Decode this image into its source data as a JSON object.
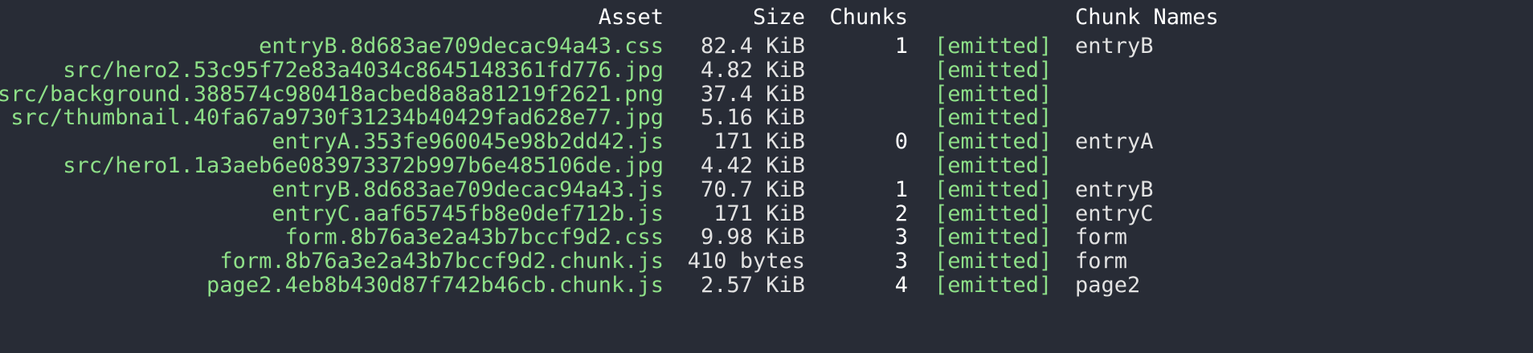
{
  "header": {
    "asset": "Asset",
    "size": "Size",
    "chunks": "Chunks",
    "status": "",
    "chunk_names": "Chunk Names"
  },
  "rows": [
    {
      "asset": "entryB.8d683ae709decac94a43.css",
      "size": "82.4 KiB",
      "chunks": "1",
      "status": "[emitted]",
      "names": "entryB"
    },
    {
      "asset": "src/hero2.53c95f72e83a4034c8645148361fd776.jpg",
      "size": "4.82 KiB",
      "chunks": "",
      "status": "[emitted]",
      "names": ""
    },
    {
      "asset": "src/background.388574c980418acbed8a8a81219f2621.png",
      "size": "37.4 KiB",
      "chunks": "",
      "status": "[emitted]",
      "names": ""
    },
    {
      "asset": "src/thumbnail.40fa67a9730f31234b40429fad628e77.jpg",
      "size": "5.16 KiB",
      "chunks": "",
      "status": "[emitted]",
      "names": ""
    },
    {
      "asset": "entryA.353fe960045e98b2dd42.js",
      "size": "171 KiB",
      "chunks": "0",
      "status": "[emitted]",
      "names": "entryA"
    },
    {
      "asset": "src/hero1.1a3aeb6e083973372b997b6e485106de.jpg",
      "size": "4.42 KiB",
      "chunks": "",
      "status": "[emitted]",
      "names": ""
    },
    {
      "asset": "entryB.8d683ae709decac94a43.js",
      "size": "70.7 KiB",
      "chunks": "1",
      "status": "[emitted]",
      "names": "entryB"
    },
    {
      "asset": "entryC.aaf65745fb8e0def712b.js",
      "size": "171 KiB",
      "chunks": "2",
      "status": "[emitted]",
      "names": "entryC"
    },
    {
      "asset": "form.8b76a3e2a43b7bccf9d2.css",
      "size": "9.98 KiB",
      "chunks": "3",
      "status": "[emitted]",
      "names": "form"
    },
    {
      "asset": "form.8b76a3e2a43b7bccf9d2.chunk.js",
      "size": "410 bytes",
      "chunks": "3",
      "status": "[emitted]",
      "names": "form"
    },
    {
      "asset": "page2.4eb8b430d87f742b46cb.chunk.js",
      "size": "2.57 KiB",
      "chunks": "4",
      "status": "[emitted]",
      "names": "page2"
    }
  ],
  "colors": {
    "background": "#282c36",
    "asset_text": "#8ee088",
    "status_text": "#8ee088",
    "plain_text": "#e2e2e2",
    "header_text": "#ffffff"
  }
}
